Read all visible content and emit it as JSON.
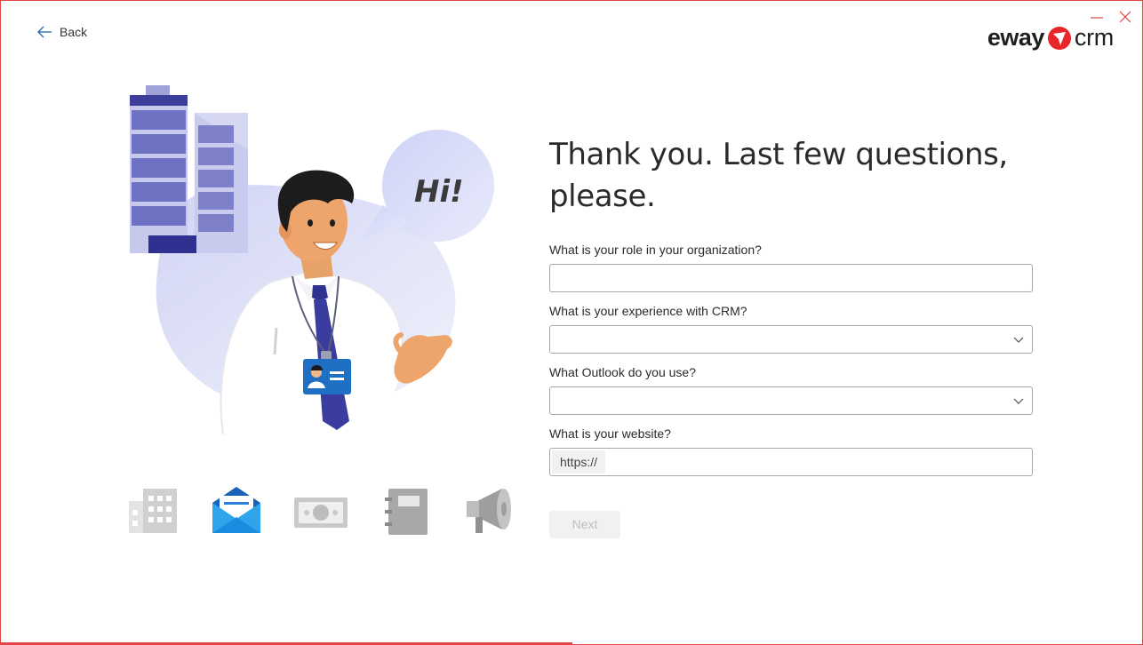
{
  "window": {
    "minimize_icon": "minimize-icon",
    "close_icon": "close-icon",
    "accent_color": "#e04848"
  },
  "nav": {
    "back_label": "Back"
  },
  "logo": {
    "brand_left": "eway",
    "brand_right": "crm",
    "mark_color": "#e8262a"
  },
  "illustration": {
    "speech_bubble_text": "Hi!"
  },
  "form": {
    "title": "Thank you. Last few questions, please.",
    "fields": [
      {
        "label": "What is your role in your organization?",
        "type": "text",
        "value": ""
      },
      {
        "label": "What is your experience with CRM?",
        "type": "select",
        "value": ""
      },
      {
        "label": "What Outlook do you use?",
        "type": "select",
        "value": ""
      },
      {
        "label": "What is your website?",
        "type": "text",
        "prefix": "https://",
        "value": ""
      }
    ],
    "next_label": "Next"
  },
  "app_icons": [
    "building-icon",
    "mail-icon",
    "money-icon",
    "notebook-icon",
    "megaphone-icon"
  ]
}
